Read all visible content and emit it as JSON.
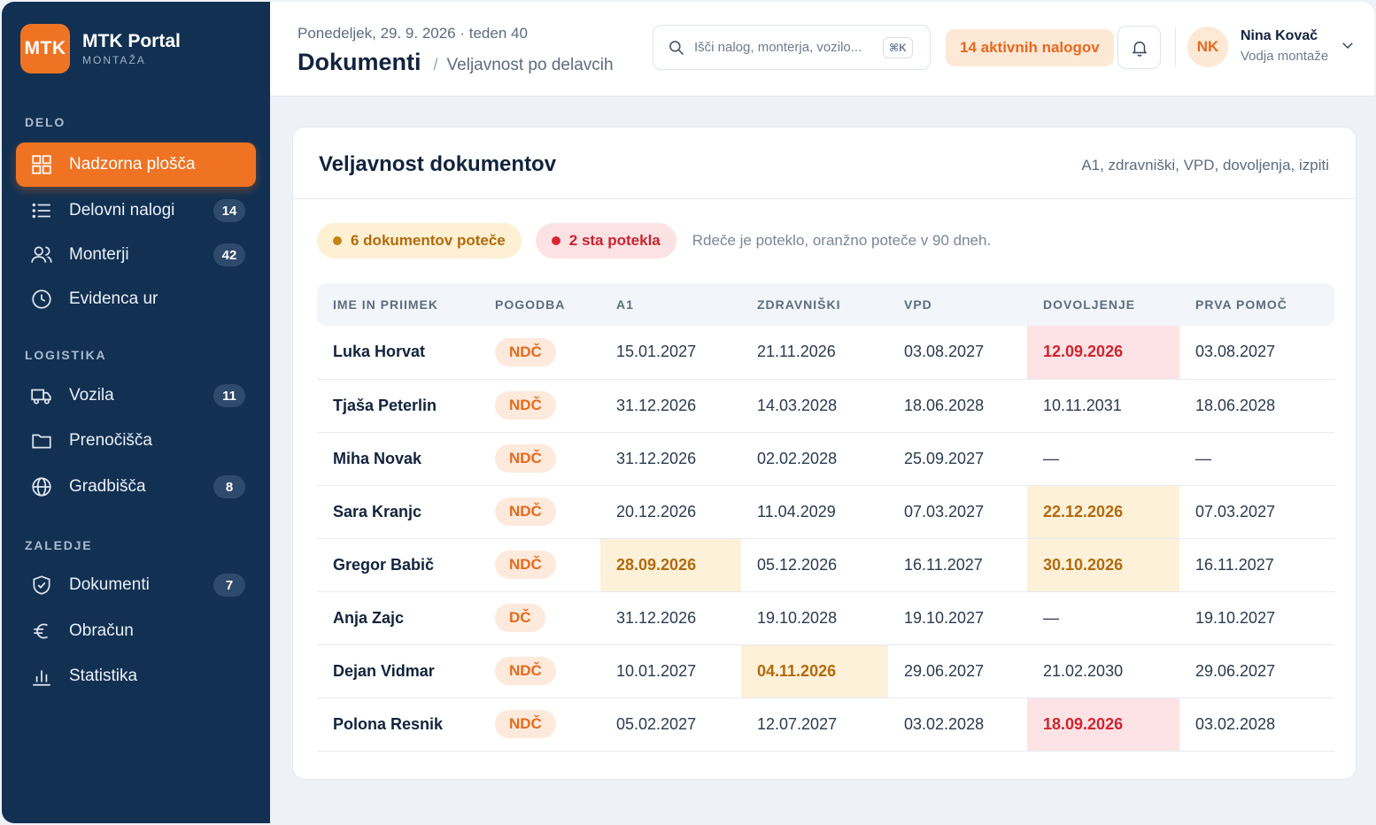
{
  "brand": {
    "logo": "MTK",
    "name": "MTK Portal",
    "sub": "MONTAŽA"
  },
  "sidebar": {
    "sections": [
      {
        "title": "DELO",
        "items": [
          {
            "label": "Nadzorna plošča",
            "icon": "dashboard-icon",
            "active": true
          },
          {
            "label": "Delovni nalogi",
            "icon": "list-icon",
            "badge": "14"
          },
          {
            "label": "Monterji",
            "icon": "users-icon",
            "badge": "42"
          },
          {
            "label": "Evidenca ur",
            "icon": "clock-icon"
          }
        ]
      },
      {
        "title": "LOGISTIKA",
        "items": [
          {
            "label": "Vozila",
            "icon": "truck-icon",
            "badge": "11"
          },
          {
            "label": "Prenočišča",
            "icon": "folder-icon"
          },
          {
            "label": "Gradbišča",
            "icon": "globe-icon",
            "badge": "8"
          }
        ]
      },
      {
        "title": "ZALEDJE",
        "items": [
          {
            "label": "Dokumenti",
            "icon": "shield-icon",
            "badge": "7"
          },
          {
            "label": "Obračun",
            "icon": "euro-icon"
          },
          {
            "label": "Statistika",
            "icon": "bar-chart-icon"
          }
        ]
      }
    ]
  },
  "header": {
    "date_line": "Ponedeljek, 29. 9. 2026 · teden 40",
    "title": "Dokumenti",
    "crumb_sep": "/",
    "crumb_sub": "Veljavnost po delavcih",
    "search_placeholder": "Išči nalog, monterja, vozilo...",
    "search_shortcut": "⌘K",
    "active_orders": "14 aktivnih nalogov",
    "user": {
      "initials": "NK",
      "name": "Nina Kovač",
      "role": "Vodja montaže"
    }
  },
  "card": {
    "title": "Veljavnost dokumentov",
    "subtitle": "A1, zdravniški, VPD, dovoljenja, izpiti",
    "pill_warn": "6 dokumentov poteče",
    "pill_err": "2 sta potekla",
    "legend_note": "Rdeče je poteklo, oranžno poteče v 90 dneh.",
    "columns": [
      "IME IN PRIIMEK",
      "POGODBA",
      "A1",
      "ZDRAVNIŠKI",
      "VPD",
      "DOVOLJENJE",
      "PRVA POMOČ"
    ],
    "rows": [
      {
        "name": "Luka Horvat",
        "contract": "NDČ",
        "cells": [
          "15.01.2027",
          "21.11.2026",
          "03.08.2027",
          "12.09.2026",
          "03.08.2027"
        ],
        "status": [
          "",
          "",
          "",
          "expired",
          ""
        ]
      },
      {
        "name": "Tjaša Peterlin",
        "contract": "NDČ",
        "cells": [
          "31.12.2026",
          "14.03.2028",
          "18.06.2028",
          "10.11.2031",
          "18.06.2028"
        ],
        "status": [
          "",
          "",
          "",
          "",
          ""
        ]
      },
      {
        "name": "Miha Novak",
        "contract": "NDČ",
        "cells": [
          "31.12.2026",
          "02.02.2028",
          "25.09.2027",
          "—",
          "—"
        ],
        "status": [
          "",
          "",
          "",
          "",
          ""
        ]
      },
      {
        "name": "Sara Kranjc",
        "contract": "NDČ",
        "cells": [
          "20.12.2026",
          "11.04.2029",
          "07.03.2027",
          "22.12.2026",
          "07.03.2027"
        ],
        "status": [
          "",
          "",
          "",
          "expiring",
          ""
        ]
      },
      {
        "name": "Gregor Babič",
        "contract": "NDČ",
        "cells": [
          "28.09.2026",
          "05.12.2026",
          "16.11.2027",
          "30.10.2026",
          "16.11.2027"
        ],
        "status": [
          "expiring",
          "",
          "",
          "expiring",
          ""
        ]
      },
      {
        "name": "Anja Zajc",
        "contract": "DČ",
        "cells": [
          "31.12.2026",
          "19.10.2028",
          "19.10.2027",
          "—",
          "19.10.2027"
        ],
        "status": [
          "",
          "",
          "",
          "",
          ""
        ]
      },
      {
        "name": "Dejan Vidmar",
        "contract": "NDČ",
        "cells": [
          "10.01.2027",
          "04.11.2026",
          "29.06.2027",
          "21.02.2030",
          "29.06.2027"
        ],
        "status": [
          "",
          "expiring",
          "",
          "",
          ""
        ]
      },
      {
        "name": "Polona Resnik",
        "contract": "NDČ",
        "cells": [
          "05.02.2027",
          "12.07.2027",
          "03.02.2028",
          "18.09.2026",
          "03.02.2028"
        ],
        "status": [
          "",
          "",
          "",
          "expired",
          ""
        ]
      }
    ]
  },
  "colors": {
    "sidebar": "#123052",
    "accent": "#ef7322",
    "expired": "#d1242f",
    "expiring": "#b36a0c"
  }
}
